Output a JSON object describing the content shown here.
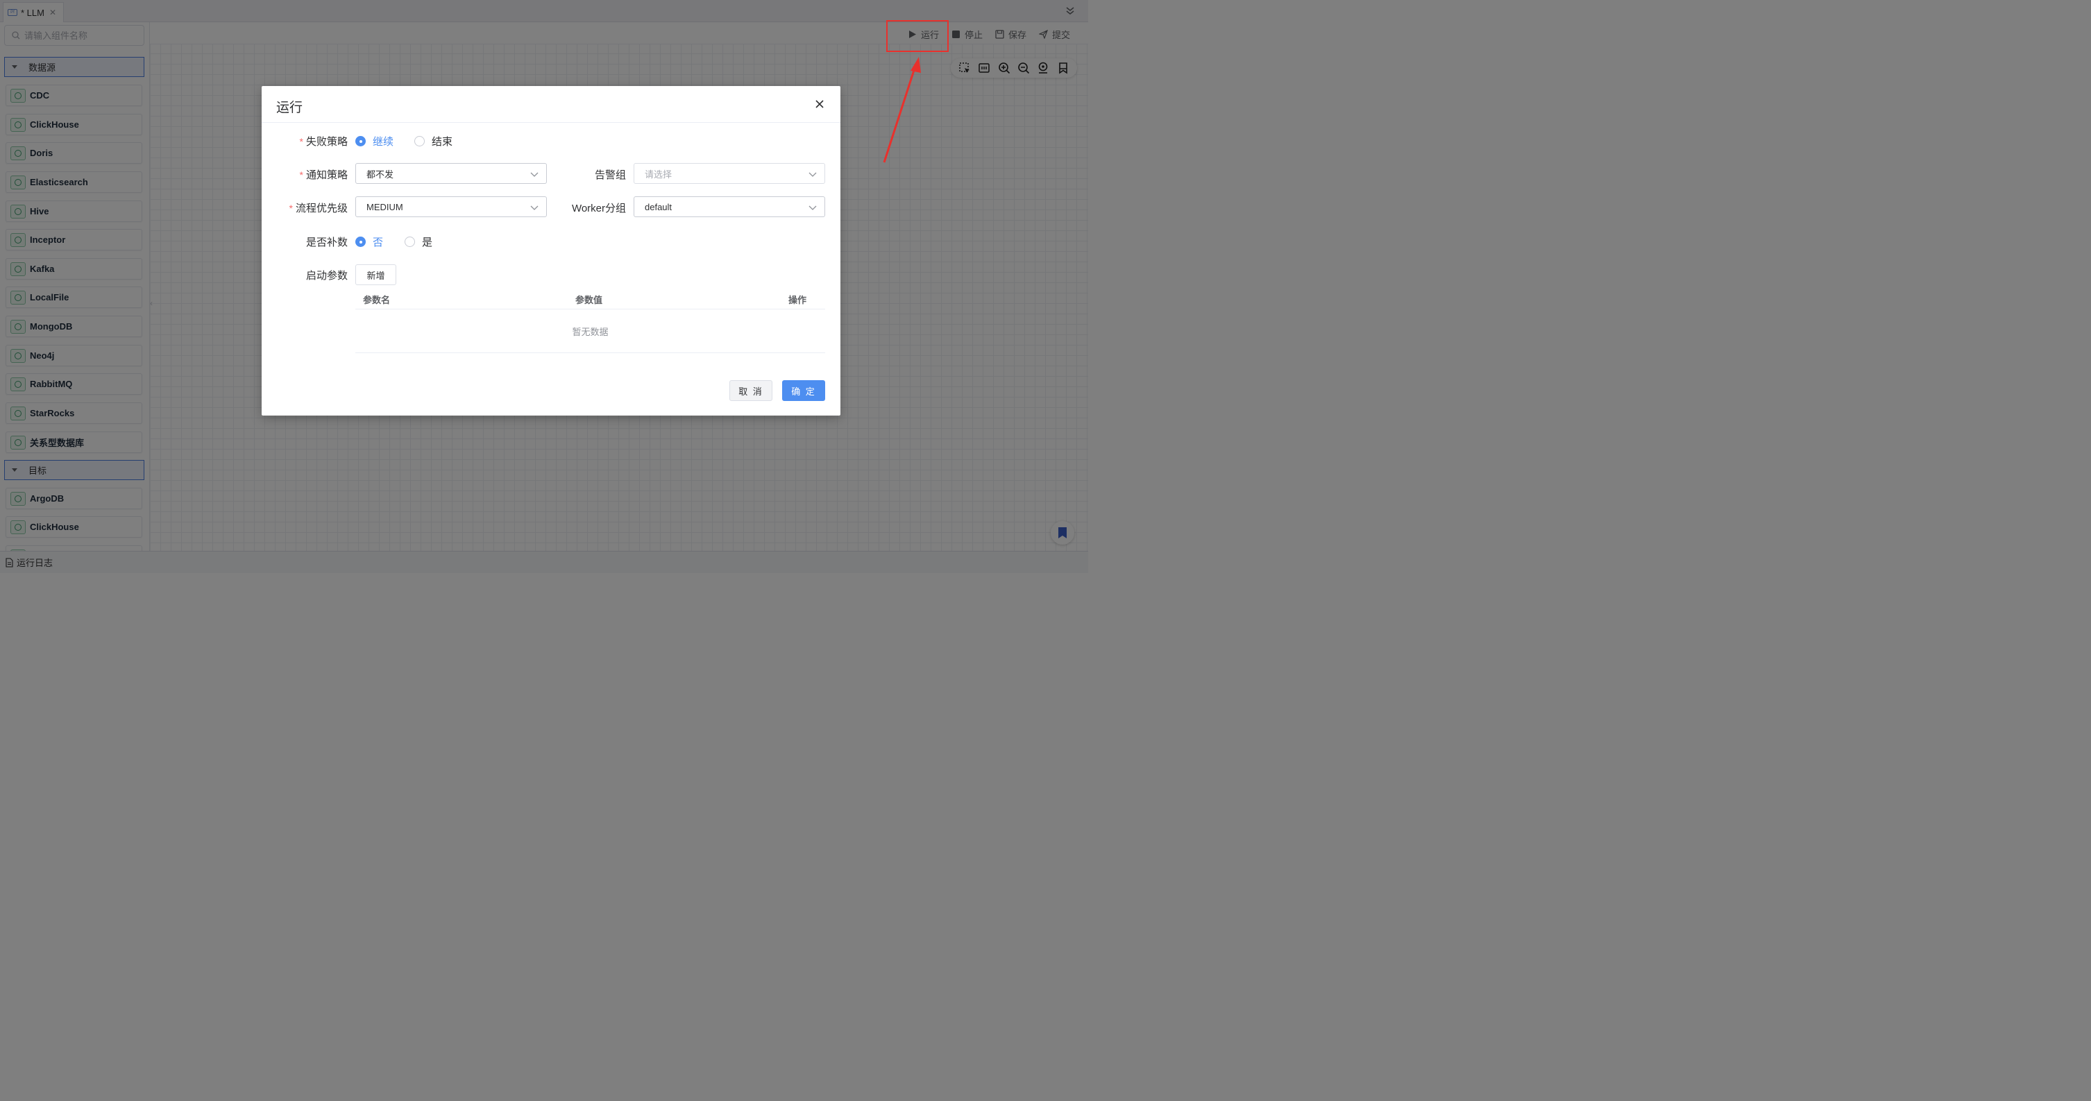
{
  "tab": {
    "title": "* LLM",
    "file_icon_text": "Pf"
  },
  "sidebar": {
    "search_placeholder": "请输入组件名称",
    "source_group": "数据源",
    "sources": [
      "CDC",
      "ClickHouse",
      "Doris",
      "Elasticsearch",
      "Hive",
      "Inceptor",
      "Kafka",
      "LocalFile",
      "MongoDB",
      "Neo4j",
      "RabbitMQ",
      "StarRocks",
      "关系型数据库"
    ],
    "target_group": "目标",
    "targets": [
      "ArgoDB",
      "ClickHouse"
    ]
  },
  "toolbar": {
    "run": "运行",
    "stop": "停止",
    "save": "保存",
    "submit": "提交"
  },
  "bottom_bar": {
    "log_label": "运行日志"
  },
  "modal": {
    "title": "运行",
    "failure_strategy": {
      "label": "失败策略",
      "options": [
        "继续",
        "结束"
      ],
      "selected": "继续"
    },
    "notify_strategy": {
      "label": "通知策略",
      "value": "都不发"
    },
    "alert_group": {
      "label": "告警组",
      "placeholder": "请选择"
    },
    "priority": {
      "label": "流程优先级",
      "value": "MEDIUM"
    },
    "worker_group": {
      "label": "Worker分组",
      "value": "default"
    },
    "backfill": {
      "label": "是否补数",
      "options": [
        "否",
        "是"
      ],
      "selected": "否"
    },
    "start_params": {
      "label": "启动参数",
      "add_button": "新增"
    },
    "table": {
      "columns": [
        "参数名",
        "参数值",
        "操作"
      ],
      "empty_text": "暂无数据"
    },
    "cancel": "取 消",
    "confirm": "确 定"
  },
  "colors": {
    "primary": "#4d8ef0",
    "highlight": "#e8312d"
  }
}
